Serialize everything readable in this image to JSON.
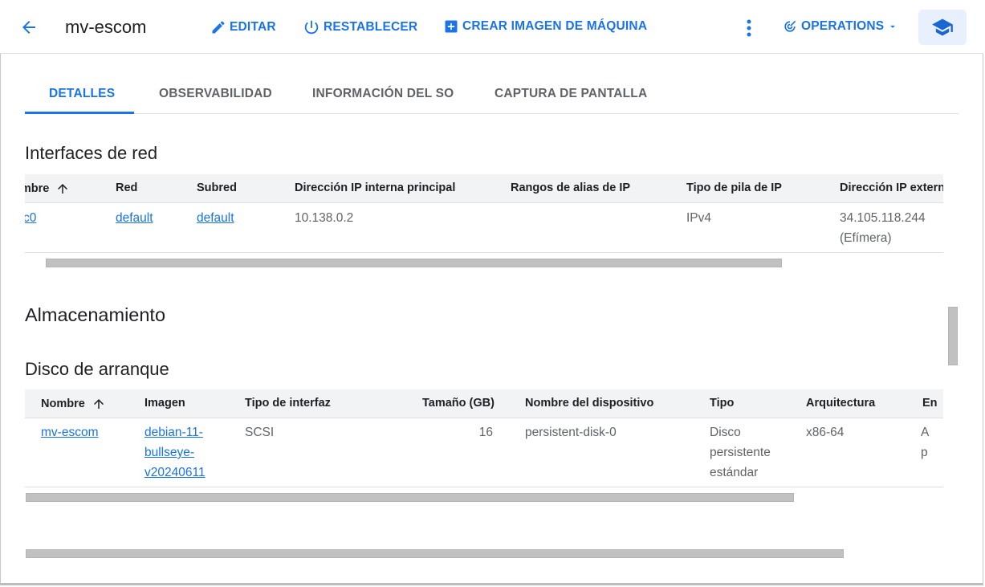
{
  "header": {
    "title": "mv-escom",
    "edit_label": "EDITAR",
    "reset_label": "RESTABLECER",
    "create_image_label": "CREAR IMAGEN DE MÁQUINA",
    "operations_label": "OPERATIONS"
  },
  "tabs": [
    {
      "label": "DETALLES",
      "active": true
    },
    {
      "label": "OBSERVABILIDAD",
      "active": false
    },
    {
      "label": "INFORMACIÓN DEL SO",
      "active": false
    },
    {
      "label": "CAPTURA DE PANTALLA",
      "active": false
    }
  ],
  "network": {
    "title": "Interfaces de red",
    "headers": [
      "ombre",
      "Red",
      "Subred",
      "Dirección IP interna principal",
      "Rangos de alias de IP",
      "Tipo de pila de IP",
      "Dirección IP externa"
    ],
    "row": {
      "name": "c0",
      "network": "default",
      "subnet": "default",
      "internal_ip": "10.138.0.2",
      "alias_ranges": "",
      "stack_type": "IPv4",
      "external_ip": "34.105.118.244",
      "external_ip_type": "(Efímera)"
    }
  },
  "storage": {
    "title": "Almacenamiento",
    "boot_disk_title": "Disco de arranque",
    "headers": [
      "Nombre",
      "Imagen",
      "Tipo de interfaz",
      "Tamaño (GB)",
      "Nombre del dispositivo",
      "Tipo",
      "Arquitectura",
      "En"
    ],
    "row": {
      "name": "mv-escom",
      "image_lines": [
        "debian-11-",
        "bullseye-",
        "v20240611"
      ],
      "interface": "SCSI",
      "size": "16",
      "device_name": "persistent-disk-0",
      "type_lines": [
        "Disco",
        "persistente",
        "estándar"
      ],
      "architecture": "x86-64",
      "extra_lines": [
        "A",
        "p"
      ]
    }
  },
  "colors": {
    "accent": "#1a73e8",
    "text": "#202124",
    "muted": "#5f6368",
    "header_bg": "#f1f3f4"
  }
}
